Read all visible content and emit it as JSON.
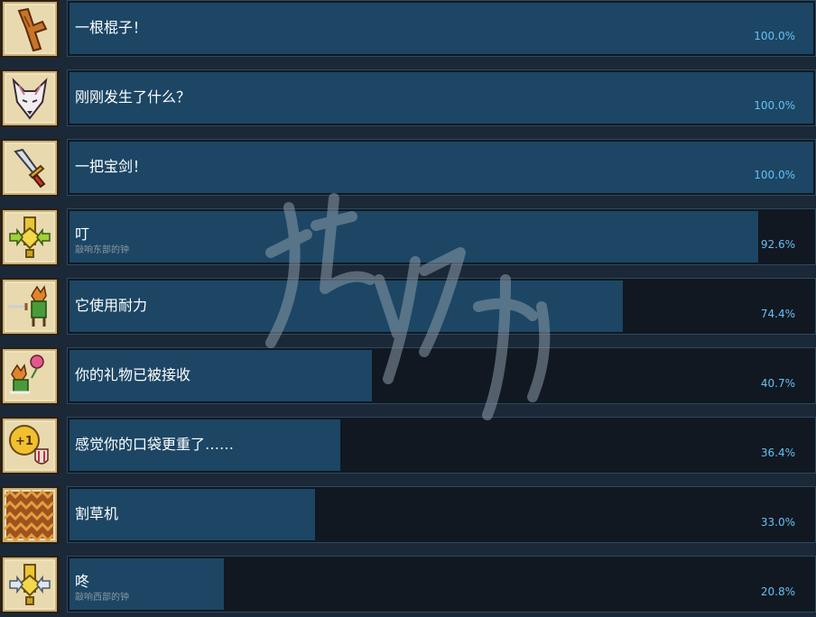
{
  "achievements": [
    {
      "title": "一根棍子！",
      "desc": "",
      "percent": "100.0%",
      "fill": 1.0,
      "icon": "stick-icon"
    },
    {
      "title": "刚刚发生了什么？",
      "desc": "",
      "percent": "100.0%",
      "fill": 1.0,
      "icon": "fox-mask-icon"
    },
    {
      "title": "一把宝剑！",
      "desc": "",
      "percent": "100.0%",
      "fill": 1.0,
      "icon": "sword-icon"
    },
    {
      "title": "叮",
      "desc": "敲响东部的钟",
      "percent": "92.6%",
      "fill": 0.926,
      "icon": "bell-east-icon"
    },
    {
      "title": "它使用耐力",
      "desc": "",
      "percent": "74.4%",
      "fill": 0.744,
      "icon": "fox-sword-icon"
    },
    {
      "title": "你的礼物已被接收",
      "desc": "",
      "percent": "40.7%",
      "fill": 0.407,
      "icon": "fox-flower-icon"
    },
    {
      "title": "感觉你的口袋更重了……",
      "desc": "",
      "percent": "36.4%",
      "fill": 0.364,
      "icon": "coin-plus-one-icon"
    },
    {
      "title": "割草机",
      "desc": "",
      "percent": "33.0%",
      "fill": 0.33,
      "icon": "grass-icon"
    },
    {
      "title": "咚",
      "desc": "敲响西部的钟",
      "percent": "20.8%",
      "fill": 0.208,
      "icon": "bell-west-icon"
    }
  ],
  "colors": {
    "page_bg": "#1b2838",
    "bar_fill": "#1c4664",
    "bar_bg": "#111821",
    "percent_text": "#66c0f4",
    "desc_text": "#8f98a0"
  }
}
